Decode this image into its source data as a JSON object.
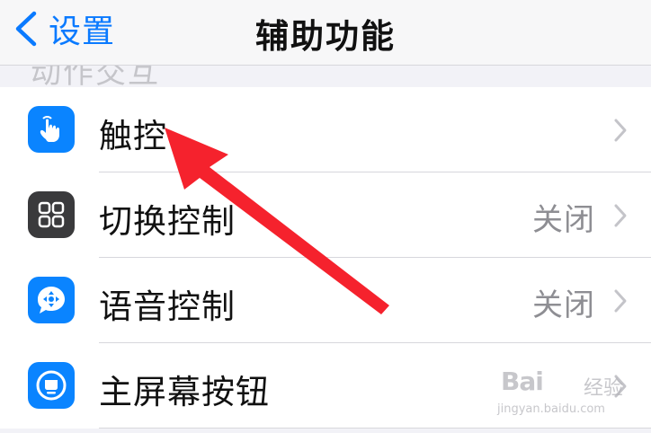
{
  "nav": {
    "back_label": "设置",
    "title": "辅助功能"
  },
  "section_hint": "动作交互",
  "rows": [
    {
      "label": "触控",
      "value": "",
      "icon": "hand-tap-icon",
      "icon_bg": "#0a84ff"
    },
    {
      "label": "切换控制",
      "value": "关闭",
      "icon": "switch-grid-icon",
      "icon_bg": "#3a3a3c"
    },
    {
      "label": "语音控制",
      "value": "关闭",
      "icon": "voice-control-icon",
      "icon_bg": "#0a84ff"
    },
    {
      "label": "主屏幕按钮",
      "value": "",
      "icon": "home-button-icon",
      "icon_bg": "#0a84ff"
    }
  ],
  "watermark": {
    "brand": "Bai",
    "brand_tail": "经验",
    "url": "jingyan.baidu.com"
  },
  "colors": {
    "accent": "#0a7aff",
    "arrow": "#f5222d",
    "separator": "#d7d7dc",
    "secondary_text": "#8e8e93"
  }
}
